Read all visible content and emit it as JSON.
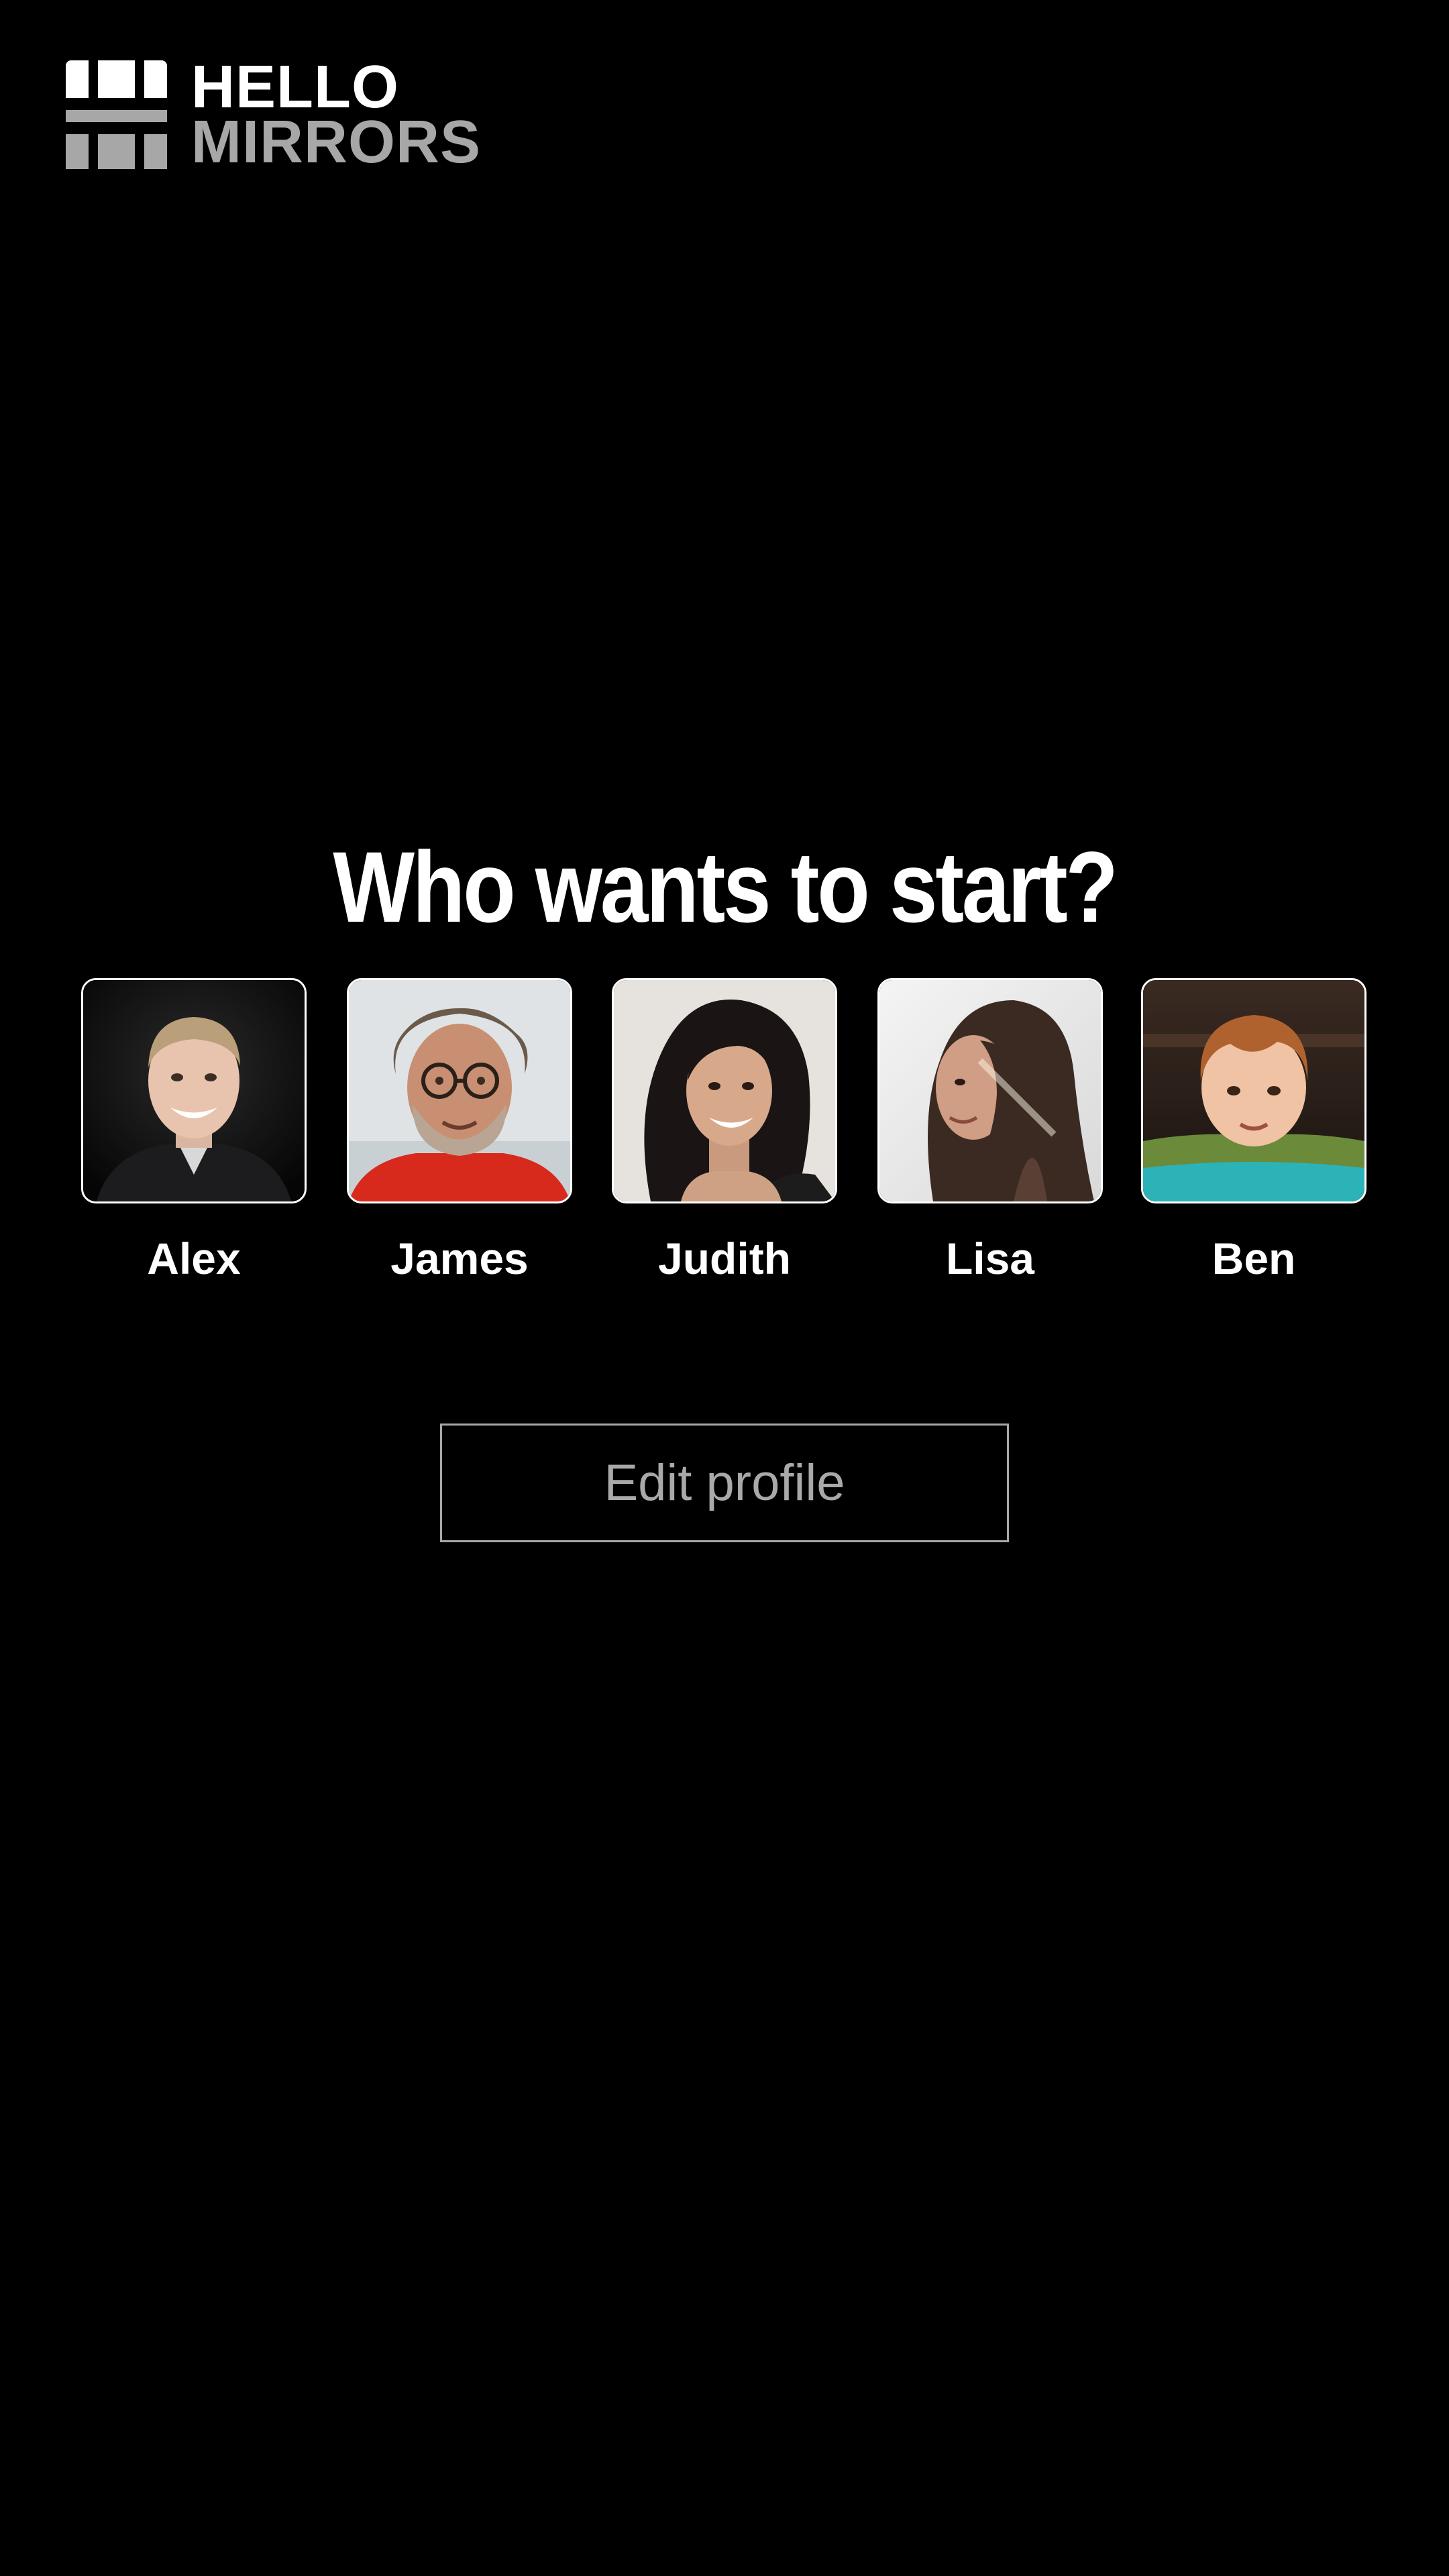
{
  "brand": {
    "line1": "HELLO",
    "line2": "MIRRORS",
    "logo_icon": "hello-mirrors-logo-icon"
  },
  "heading": "Who wants to start?",
  "profiles": [
    {
      "name": "Alex",
      "avatar": "photo-alex"
    },
    {
      "name": "James",
      "avatar": "photo-james"
    },
    {
      "name": "Judith",
      "avatar": "photo-judith"
    },
    {
      "name": "Lisa",
      "avatar": "photo-lisa"
    },
    {
      "name": "Ben",
      "avatar": "photo-ben"
    }
  ],
  "edit_profile_label": "Edit profile",
  "colors": {
    "background": "#000000",
    "text": "#ffffff",
    "muted": "#a7a7a7"
  }
}
